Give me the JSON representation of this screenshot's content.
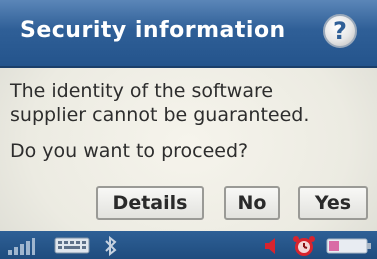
{
  "dialog": {
    "title": "Security information",
    "help_icon": "question-mark-icon",
    "message_line1": "The identity of the software",
    "message_line2": "supplier cannot be guaranteed.",
    "question": "Do you want to proceed?",
    "buttons": {
      "details": "Details",
      "no": "No",
      "yes": "Yes"
    }
  },
  "taskbar": {
    "icons": [
      "signal-strength-icon",
      "keyboard-icon",
      "bluetooth-icon",
      "volume-icon",
      "alarm-clock-icon",
      "battery-icon"
    ]
  },
  "colors": {
    "title_bar": "#2f5f97",
    "dialog_background": "#f2f1ea",
    "button_border": "#9a9a96",
    "taskbar": "#1f4c7e",
    "alert_red": "#d8242e"
  }
}
